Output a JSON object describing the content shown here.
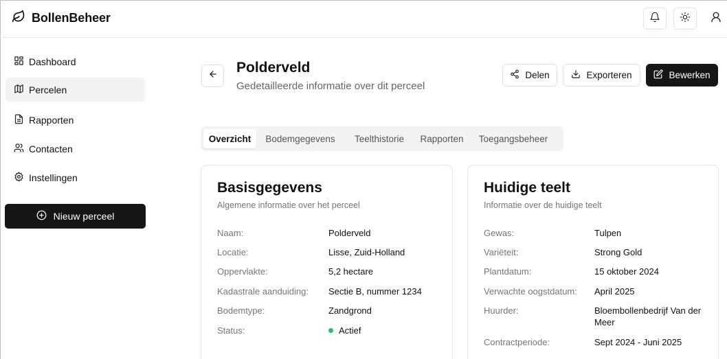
{
  "app": {
    "title": "BollenBeheer"
  },
  "sidebar": {
    "items": [
      {
        "label": "Dashboard"
      },
      {
        "label": "Percelen"
      },
      {
        "label": "Rapporten"
      },
      {
        "label": "Contacten"
      },
      {
        "label": "Instellingen"
      }
    ],
    "new_button": "Nieuw perceel"
  },
  "page": {
    "title": "Polderveld",
    "subtitle": "Gedetailleerde informatie over dit perceel"
  },
  "actions": {
    "share": "Delen",
    "export": "Exporteren",
    "edit": "Bewerken"
  },
  "tabs": [
    "Overzicht",
    "Bodemgegevens",
    "Teelthistorie",
    "Rapporten",
    "Toegangsbeheer"
  ],
  "basis": {
    "title": "Basisgegevens",
    "subtitle": "Algemene informatie over het perceel",
    "rows": [
      {
        "label": "Naam:",
        "value": "Polderveld"
      },
      {
        "label": "Locatie:",
        "value": "Lisse, Zuid-Holland"
      },
      {
        "label": "Oppervlakte:",
        "value": "5,2 hectare"
      },
      {
        "label": "Kadastrale aanduiding:",
        "value": "Sectie B, nummer 1234"
      },
      {
        "label": "Bodemtype:",
        "value": "Zandgrond"
      },
      {
        "label": "Status:",
        "value": "Actief"
      }
    ]
  },
  "teelt": {
    "title": "Huidige teelt",
    "subtitle": "Informatie over de huidige teelt",
    "rows": [
      {
        "label": "Gewas:",
        "value": "Tulpen"
      },
      {
        "label": "Variëteit:",
        "value": "Strong Gold"
      },
      {
        "label": "Plantdatum:",
        "value": "15 oktober 2024"
      },
      {
        "label": "Verwachte oogstdatum:",
        "value": "April 2025"
      },
      {
        "label": "Huurder:",
        "value": "Bloembollenbedrijf Van der Meer"
      },
      {
        "label": "Contractperiode:",
        "value": "Sept 2024 - Juni 2025"
      }
    ]
  },
  "icons": {
    "brand": "leaf-icon",
    "notifications": "bell-icon",
    "theme": "sun-icon",
    "user": "user-icon"
  },
  "colors": {
    "primary": "#161616",
    "status_active": "#22c55e"
  }
}
